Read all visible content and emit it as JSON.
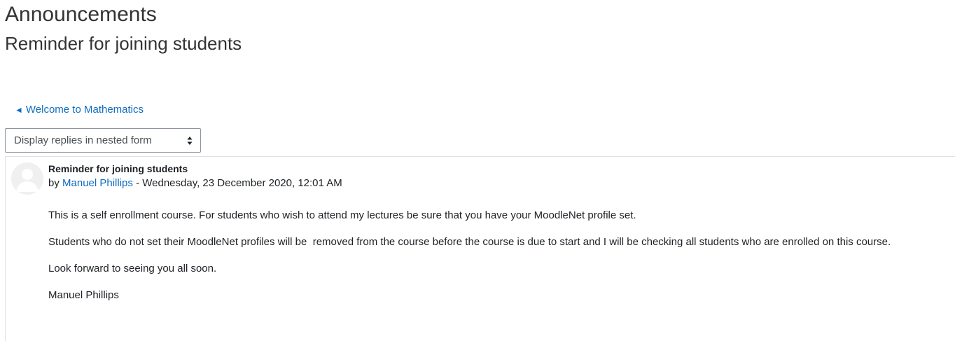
{
  "forum": {
    "title": "Announcements"
  },
  "discussion": {
    "title": "Reminder for joining students"
  },
  "navigation": {
    "previous_arrow": "◄",
    "previous_label": "Welcome to Mathematics"
  },
  "display_mode": {
    "selected": "Display replies in nested form"
  },
  "post": {
    "subject": "Reminder for joining students",
    "by_prefix": "by",
    "author": "Manuel Phillips",
    "separator": " - ",
    "date": "Wednesday, 23 December 2020, 12:01 AM",
    "paragraphs": [
      "This is a self enrollment course. For students who wish to attend my lectures be sure that you have your MoodleNet profile set.",
      "Students who do not set their MoodleNet profiles will be  removed from the course before the course is due to start and I will be checking all students who are enrolled on this course.",
      "Look forward to seeing you all soon.",
      "Manuel Phillips"
    ]
  },
  "colors": {
    "link": "#0f6cbf",
    "text": "#1d2125",
    "border": "#dee2e6"
  }
}
